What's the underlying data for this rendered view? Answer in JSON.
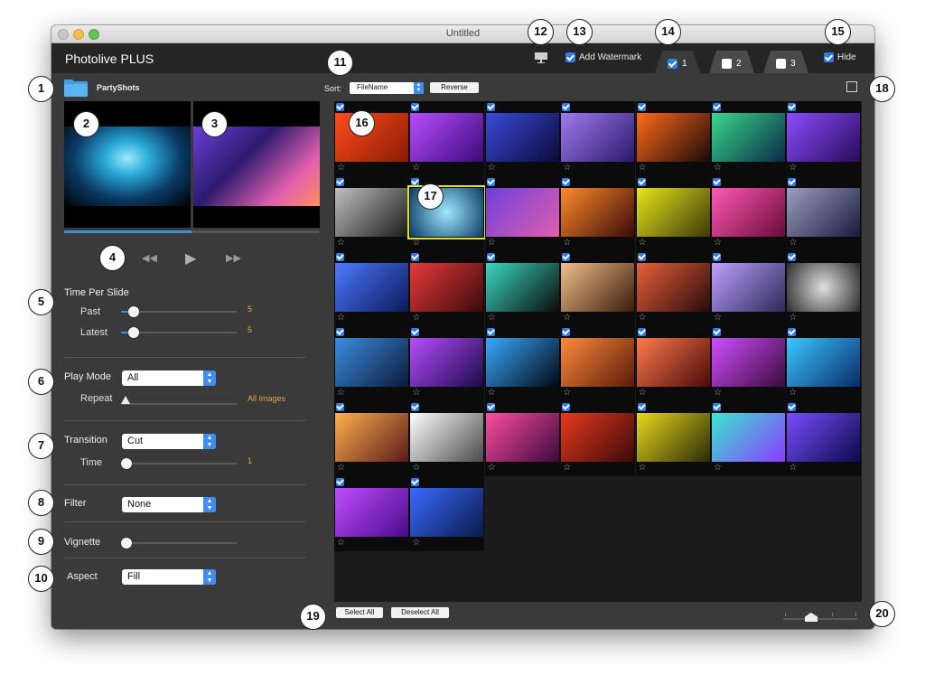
{
  "window": {
    "title": "Untitled"
  },
  "toolbar": {
    "app_name": "Photolive PLUS",
    "watermark": {
      "label": "Add Watermark",
      "checked": true
    },
    "tabs": [
      {
        "label": "1",
        "checked": true,
        "active": true
      },
      {
        "label": "2",
        "checked": false,
        "active": false
      },
      {
        "label": "3",
        "checked": false,
        "active": false
      }
    ],
    "hide": {
      "label": "Hide",
      "checked": true
    }
  },
  "sidebar": {
    "folder_name": "PartyShots",
    "playback_progress": 0.5,
    "transport": {
      "rewind": "◀◀",
      "play": "▶",
      "forward": "▶▶"
    },
    "time_per_slide": {
      "title": "Time Per Slide",
      "past_label": "Past",
      "past_value": "5",
      "latest_label": "Latest",
      "latest_value": "5"
    },
    "play_mode": {
      "label": "Play Mode",
      "value": "All",
      "repeat_label": "Repeat",
      "repeat_value": "All Images"
    },
    "transition": {
      "label": "Transition",
      "value": "Cut",
      "time_label": "Time",
      "time_value": "1"
    },
    "filter": {
      "label": "Filter",
      "value": "None"
    },
    "vignette": {
      "label": "Vignette"
    },
    "aspect": {
      "label": "Aspect",
      "value": "Fill"
    }
  },
  "grid": {
    "sort_label": "Sort:",
    "sort_value": "FileName",
    "reverse_label": "Reverse",
    "select_all_label": "Select All",
    "deselect_all_label": "Deselect All",
    "selected_index": 8,
    "total_images": 37
  },
  "callouts": [
    "1",
    "2",
    "3",
    "4",
    "5",
    "6",
    "7",
    "8",
    "9",
    "10",
    "11",
    "12",
    "13",
    "14",
    "15",
    "16",
    "17",
    "18",
    "19",
    "20"
  ],
  "colors": {
    "accent": "#3a8de0",
    "value_orange": "#e9a53a",
    "selection_yellow": "#e8e41a"
  }
}
